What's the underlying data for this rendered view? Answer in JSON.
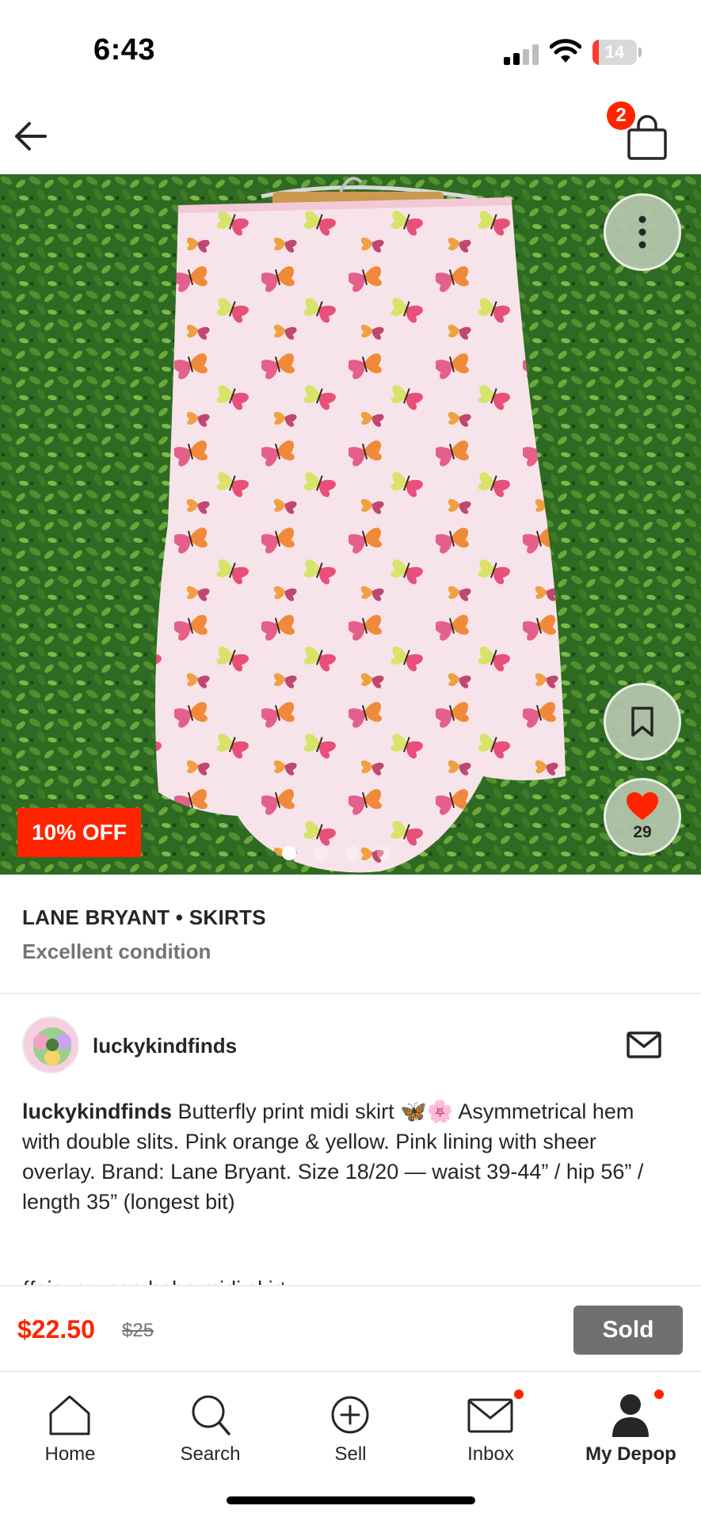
{
  "status_bar": {
    "time": "6:43",
    "battery": "14",
    "battery_level": 0.14
  },
  "header": {
    "cart_count": "2"
  },
  "product": {
    "discount_badge": "10% OFF",
    "likes": "29",
    "image_count": 4,
    "active_image": 1,
    "brand_category": "LANE BRYANT • SKIRTS",
    "condition": "Excellent condition"
  },
  "seller": {
    "username": "luckykindfinds"
  },
  "description": {
    "author": "luckykindfinds",
    "text": " Butterfly print midi skirt 🦋🌸 Asymmetrical hem with double slits. Pink orange & yellow. Pink lining with sheer overlay. Brand: Lane Bryant. Size 18/20 — waist 39-44” / hip 56” / length 35” (longest bit)",
    "cut_line": "{fairy grunge boho midi skirt"
  },
  "price": {
    "current": "$22.50",
    "original": "$25",
    "status_label": "Sold"
  },
  "tabs": [
    {
      "label": "Home",
      "icon": "home-icon"
    },
    {
      "label": "Search",
      "icon": "search-icon"
    },
    {
      "label": "Sell",
      "icon": "plus-circle-icon"
    },
    {
      "label": "Inbox",
      "icon": "mail-icon"
    },
    {
      "label": "My Depop",
      "icon": "person-icon"
    }
  ],
  "colors": {
    "accent": "#ff2300",
    "sold": "#707070",
    "muted_text": "#747474"
  }
}
